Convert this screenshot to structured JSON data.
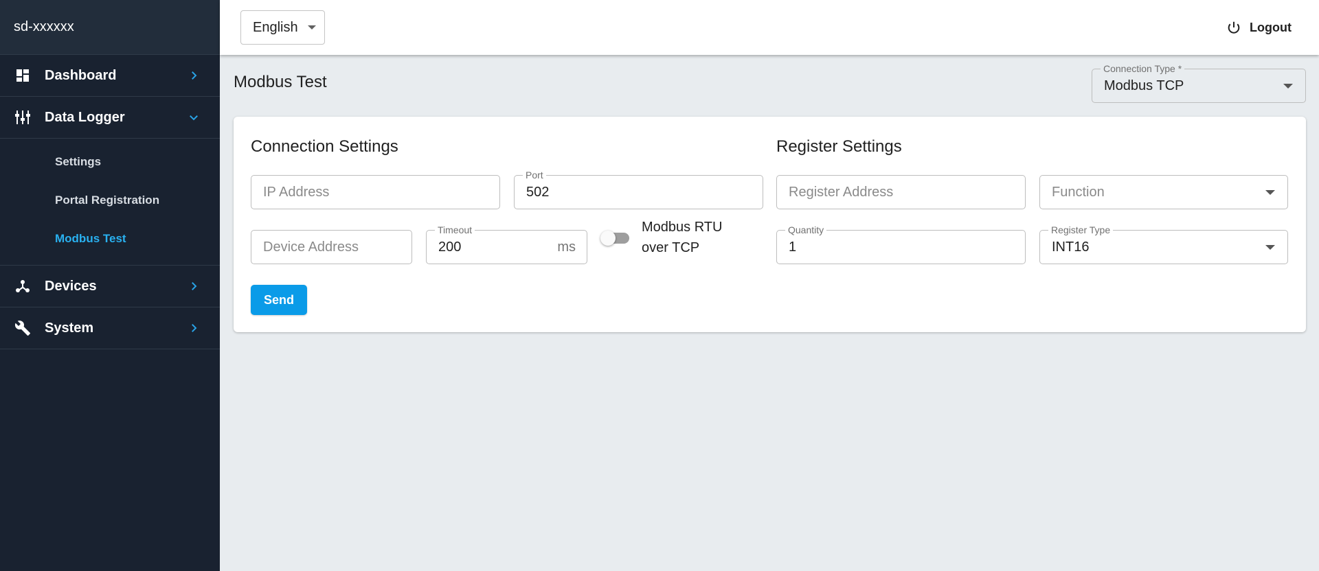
{
  "sidebar": {
    "brand": "sd-xxxxxx",
    "items": [
      {
        "label": "Dashboard",
        "icon": "dashboard-icon"
      },
      {
        "label": "Data Logger",
        "icon": "equalizer-icon",
        "expanded": true,
        "subitems": [
          "Settings",
          "Portal Registration",
          "Modbus Test"
        ]
      },
      {
        "label": "Devices",
        "icon": "hub-icon"
      },
      {
        "label": "System",
        "icon": "wrench-icon"
      }
    ],
    "active_subitem": "Modbus Test"
  },
  "header": {
    "language": "English",
    "logout_label": "Logout"
  },
  "page": {
    "title": "Modbus Test",
    "connection_type": {
      "label": "Connection Type *",
      "value": "Modbus TCP"
    }
  },
  "connection": {
    "title": "Connection Settings",
    "ip_placeholder": "IP Address",
    "port_label": "Port",
    "port_value": "502",
    "device_placeholder": "Device Address",
    "timeout_label": "Timeout",
    "timeout_value": "200",
    "timeout_unit": "ms",
    "rtu_toggle_line1": "Modbus RTU",
    "rtu_toggle_line2": "over TCP",
    "rtu_toggle_on": false
  },
  "register": {
    "title": "Register Settings",
    "address_placeholder": "Register Address",
    "function_placeholder": "Function",
    "quantity_label": "Quantity",
    "quantity_value": "1",
    "type_label": "Register Type",
    "type_value": "INT16"
  },
  "actions": {
    "send_label": "Send"
  },
  "colors": {
    "sidebar_bg": "#192230",
    "accent": "#0a9be8",
    "active_link": "#29b1f0",
    "page_bg": "#e8ecef"
  }
}
